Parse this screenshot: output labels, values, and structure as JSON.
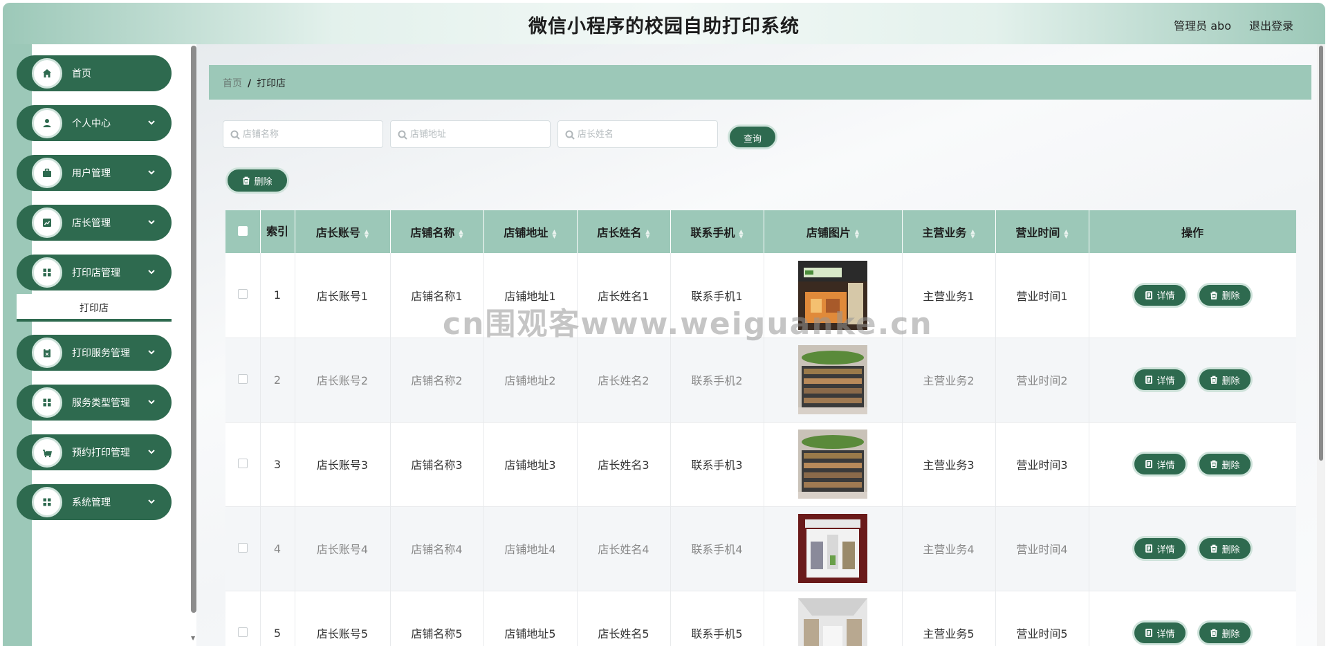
{
  "header": {
    "title": "微信小程序的校园自助打印系统",
    "admin": "管理员 abo",
    "logout": "退出登录"
  },
  "sidebar": {
    "items": [
      {
        "label": "首页",
        "icon": "home-icon"
      },
      {
        "label": "个人中心",
        "icon": "user-icon"
      },
      {
        "label": "用户管理",
        "icon": "briefcase-icon"
      },
      {
        "label": "店长管理",
        "icon": "chart-icon"
      },
      {
        "label": "打印店管理",
        "icon": "grid-icon"
      },
      {
        "label": "打印服务管理",
        "icon": "clipboard-icon"
      },
      {
        "label": "服务类型管理",
        "icon": "grid-icon"
      },
      {
        "label": "预约打印管理",
        "icon": "cart-icon"
      },
      {
        "label": "系统管理",
        "icon": "grid-icon"
      }
    ],
    "submenu": "打印店"
  },
  "breadcrumb": {
    "home": "首页",
    "separator": "/",
    "current": "打印店"
  },
  "search": {
    "shop_name_placeholder": "店铺名称",
    "shop_address_placeholder": "店铺地址",
    "owner_name_placeholder": "店长姓名",
    "query_label": "查询"
  },
  "toolbar": {
    "delete_label": "删除"
  },
  "table": {
    "headers": [
      "索引",
      "店长账号",
      "店铺名称",
      "店铺地址",
      "店长姓名",
      "联系手机",
      "店铺图片",
      "主营业务",
      "营业时间",
      "操作"
    ],
    "rows": [
      {
        "index": "1",
        "account": "店长账号1",
        "name": "店铺名称1",
        "address": "店铺地址1",
        "owner": "店长姓名1",
        "phone": "联系手机1",
        "business": "主营业务1",
        "hours": "营业时间1"
      },
      {
        "index": "2",
        "account": "店长账号2",
        "name": "店铺名称2",
        "address": "店铺地址2",
        "owner": "店长姓名2",
        "phone": "联系手机2",
        "business": "主营业务2",
        "hours": "营业时间2"
      },
      {
        "index": "3",
        "account": "店长账号3",
        "name": "店铺名称3",
        "address": "店铺地址3",
        "owner": "店长姓名3",
        "phone": "联系手机3",
        "business": "主营业务3",
        "hours": "营业时间3"
      },
      {
        "index": "4",
        "account": "店长账号4",
        "name": "店铺名称4",
        "address": "店铺地址4",
        "owner": "店长姓名4",
        "phone": "联系手机4",
        "business": "主营业务4",
        "hours": "营业时间4"
      },
      {
        "index": "5",
        "account": "店长账号5",
        "name": "店铺名称5",
        "address": "店铺地址5",
        "owner": "店长姓名5",
        "phone": "联系手机5",
        "business": "主营业务5",
        "hours": "营业时间5"
      }
    ],
    "detail_label": "详情",
    "delete_label": "删除"
  },
  "watermark": "cn围观客www.weiguanke.cn",
  "colors": {
    "primary": "#2e6a4f",
    "accent": "#9cc8b8",
    "stripe": "#f4f6f8"
  }
}
